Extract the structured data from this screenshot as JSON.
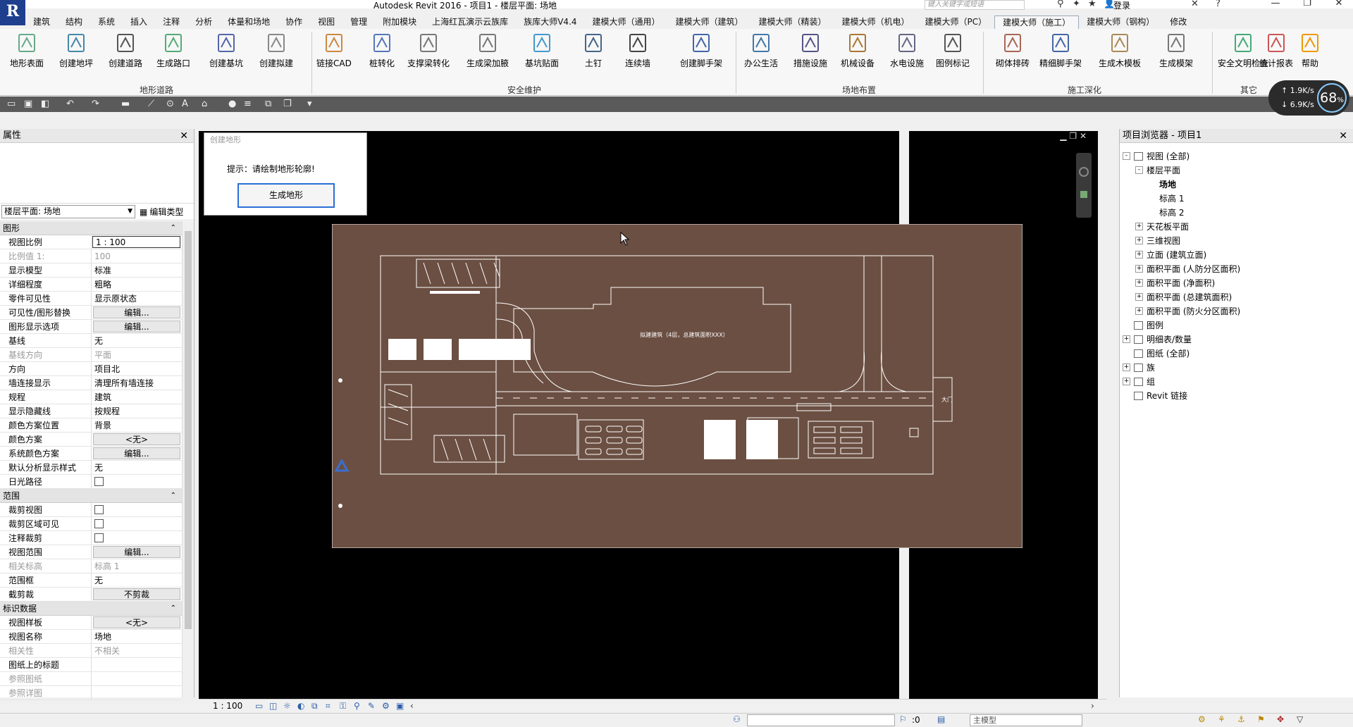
{
  "window": {
    "title": "Autodesk Revit 2016 -     项目1 - 楼层平面: 场地",
    "search_placeholder": "键入关键字或短语",
    "login": "登录"
  },
  "ribbon_tabs": [
    "建筑",
    "结构",
    "系统",
    "插入",
    "注释",
    "分析",
    "体量和场地",
    "协作",
    "视图",
    "管理",
    "附加模块",
    "上海红瓦演示云族库",
    "族库大师V4.4",
    "建模大师（通用）",
    "建模大师（建筑）",
    "建模大师（精装）",
    "建模大师（机电）",
    "建模大师（PC）",
    "建模大师（施工）",
    "建模大师（钢构）",
    "修改"
  ],
  "active_tab": "建模大师（施工）",
  "ribbon": {
    "buttons": [
      {
        "label": "地形表面",
        "icon": "terrain-surface-icon"
      },
      {
        "label": "创建地坪",
        "icon": "pad-icon"
      },
      {
        "label": "创建道路",
        "icon": "road-icon"
      },
      {
        "label": "生成路口",
        "icon": "intersection-icon"
      },
      {
        "label": "创建基坑",
        "icon": "pit-icon"
      },
      {
        "label": "创建拟建",
        "icon": "proposed-building-icon"
      },
      {
        "label": "链接CAD",
        "icon": "link-cad-icon"
      },
      {
        "label": "桩转化",
        "icon": "pile-icon"
      },
      {
        "label": "支撑梁转化",
        "icon": "support-beam-icon"
      },
      {
        "label": "生成梁加腋",
        "icon": "beam-haunch-icon"
      },
      {
        "label": "基坑贴面",
        "icon": "pit-face-icon"
      },
      {
        "label": "土钉",
        "icon": "soil-nail-icon"
      },
      {
        "label": "连续墙",
        "icon": "continuous-wall-icon"
      },
      {
        "label": "创建脚手架",
        "icon": "scaffold-icon"
      },
      {
        "label": "办公生活",
        "icon": "office-icon"
      },
      {
        "label": "措施设施",
        "icon": "measure-facility-icon"
      },
      {
        "label": "机械设备",
        "icon": "machinery-icon"
      },
      {
        "label": "水电设施",
        "icon": "water-power-icon"
      },
      {
        "label": "图例标记",
        "icon": "legend-tag-icon"
      },
      {
        "label": "砌体排砖",
        "icon": "brick-icon"
      },
      {
        "label": "精细脚手架",
        "icon": "fine-scaffold-icon"
      },
      {
        "label": "生成木模板",
        "icon": "formwork-icon"
      },
      {
        "label": "生成模架",
        "icon": "mold-frame-icon"
      },
      {
        "label": "安全文明检查",
        "icon": "safety-check-icon"
      },
      {
        "label": "统计报表",
        "icon": "report-icon"
      },
      {
        "label": "帮助",
        "icon": "help-key-icon"
      }
    ],
    "groups": [
      "地形道路",
      "安全维护",
      "场地布置",
      "施工深化",
      "其它"
    ]
  },
  "network": {
    "up": "1.9K/s",
    "down": "6.9K/s",
    "percent": "68",
    "unit": "%"
  },
  "properties": {
    "title": "属性",
    "type_selector": "楼层平面: 场地",
    "edit_type": "编辑类型",
    "sections": [
      {
        "title": "图形",
        "rows": [
          {
            "name": "视图比例",
            "value": "1 : 100",
            "kind": "edit"
          },
          {
            "name": "比例值 1:",
            "value": "100",
            "kind": "disabled"
          },
          {
            "name": "显示模型",
            "value": "标准"
          },
          {
            "name": "详细程度",
            "value": "粗略"
          },
          {
            "name": "零件可见性",
            "value": "显示原状态"
          },
          {
            "name": "可见性/图形替换",
            "value": "编辑...",
            "kind": "btn"
          },
          {
            "name": "图形显示选项",
            "value": "编辑...",
            "kind": "btn"
          },
          {
            "name": "基线",
            "value": "无"
          },
          {
            "name": "基线方向",
            "value": "平面",
            "kind": "disabled"
          },
          {
            "name": "方向",
            "value": "项目北"
          },
          {
            "name": "墙连接显示",
            "value": "清理所有墙连接"
          },
          {
            "name": "规程",
            "value": "建筑"
          },
          {
            "name": "显示隐藏线",
            "value": "按规程"
          },
          {
            "name": "颜色方案位置",
            "value": "背景"
          },
          {
            "name": "颜色方案",
            "value": "<无>",
            "kind": "btn"
          },
          {
            "name": "系统颜色方案",
            "value": "编辑...",
            "kind": "btn"
          },
          {
            "name": "默认分析显示样式",
            "value": "无"
          },
          {
            "name": "日光路径",
            "value": "",
            "kind": "check"
          }
        ]
      },
      {
        "title": "范围",
        "rows": [
          {
            "name": "裁剪视图",
            "value": "",
            "kind": "check"
          },
          {
            "name": "裁剪区域可见",
            "value": "",
            "kind": "check"
          },
          {
            "name": "注释裁剪",
            "value": "",
            "kind": "check"
          },
          {
            "name": "视图范围",
            "value": "编辑...",
            "kind": "btn"
          },
          {
            "name": "相关标高",
            "value": "标高 1",
            "kind": "disabled"
          },
          {
            "name": "范围框",
            "value": "无"
          },
          {
            "name": "截剪裁",
            "value": "不剪裁",
            "kind": "btn"
          }
        ]
      },
      {
        "title": "标识数据",
        "rows": [
          {
            "name": "视图样板",
            "value": "<无>",
            "kind": "btn"
          },
          {
            "name": "视图名称",
            "value": "场地"
          },
          {
            "name": "相关性",
            "value": "不相关",
            "kind": "disabled"
          },
          {
            "name": "图纸上的标题",
            "value": ""
          },
          {
            "name": "参照图纸",
            "value": "",
            "kind": "disabled"
          },
          {
            "name": "参照详图",
            "value": "",
            "kind": "disabled"
          }
        ]
      }
    ]
  },
  "dialog": {
    "title": "创建地形",
    "message": "提示：请绘制地形轮廓!",
    "button": "生成地形"
  },
  "drawing": {
    "building_label": "拟建建筑（4层，总建筑面积XXX）",
    "road_label": "大门"
  },
  "browser": {
    "title": "项目浏览器 - 项目1",
    "nodes": [
      {
        "label": "视图 (全部)",
        "level": 0,
        "exp": "-"
      },
      {
        "label": "楼层平面",
        "level": 1,
        "exp": "-"
      },
      {
        "label": "场地",
        "level": 2,
        "exp": "",
        "bold": true
      },
      {
        "label": "标高 1",
        "level": 2,
        "exp": ""
      },
      {
        "label": "标高 2",
        "level": 2,
        "exp": ""
      },
      {
        "label": "天花板平面",
        "level": 1,
        "exp": "+"
      },
      {
        "label": "三维视图",
        "level": 1,
        "exp": "+"
      },
      {
        "label": "立面 (建筑立面)",
        "level": 1,
        "exp": "+"
      },
      {
        "label": "面积平面 (人防分区面积)",
        "level": 1,
        "exp": "+"
      },
      {
        "label": "面积平面 (净面积)",
        "level": 1,
        "exp": "+"
      },
      {
        "label": "面积平面 (总建筑面积)",
        "level": 1,
        "exp": "+"
      },
      {
        "label": "面积平面 (防火分区面积)",
        "level": 1,
        "exp": "+"
      },
      {
        "label": "图例",
        "level": 0,
        "exp": ""
      },
      {
        "label": "明细表/数量",
        "level": 0,
        "exp": "+"
      },
      {
        "label": "图纸 (全部)",
        "level": 0,
        "exp": ""
      },
      {
        "label": "族",
        "level": 0,
        "exp": "+"
      },
      {
        "label": "组",
        "level": 0,
        "exp": "+"
      },
      {
        "label": "Revit 链接",
        "level": 0,
        "exp": ""
      }
    ]
  },
  "view_bar": {
    "scale": "1 : 100"
  },
  "status_bar": {
    "text": "",
    "zero": ":0",
    "model": "主模型"
  },
  "colors": {
    "site_fill": "#6b4f42",
    "line": "#ffffff",
    "accent": "#2a6fd6"
  }
}
